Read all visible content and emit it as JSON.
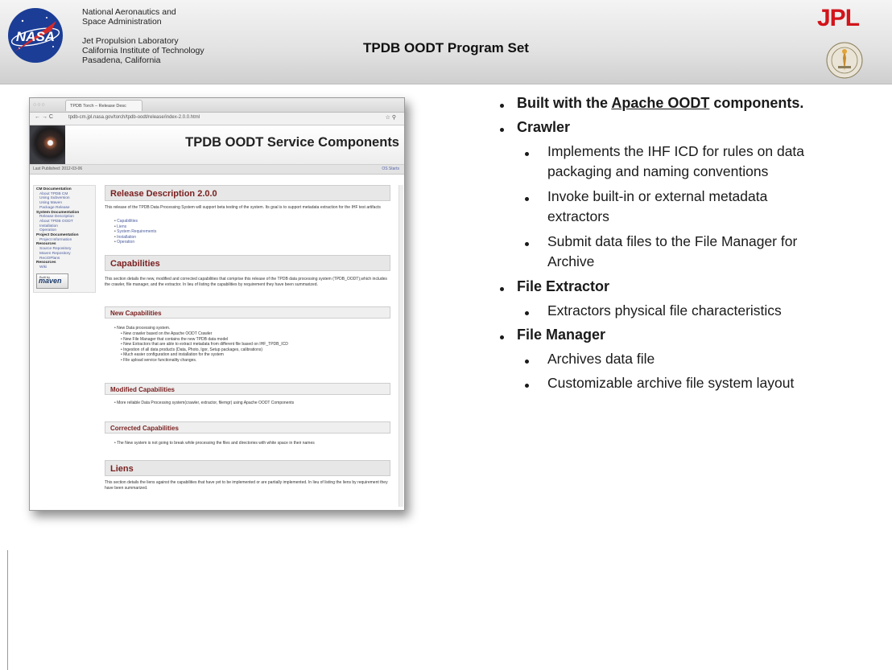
{
  "header": {
    "org_lines": [
      "National Aeronautics and",
      "Space Administration"
    ],
    "lab_lines": [
      "Jet Propulsion Laboratory",
      "California Institute of Technology",
      "Pasadena, California"
    ],
    "title": "TPDB OODT Program Set",
    "nasa_logo": "NASA",
    "jpl_logo": "JPL",
    "colors": {
      "nasa_blue": "#1b3d96",
      "nasa_red": "#d22b2b",
      "jpl_red": "#d2141b"
    }
  },
  "screenshot": {
    "tab_title": "TPDB Torch – Release Desc",
    "url": "tpdb-cm.jpl.nasa.gov/torch/tpdb-oodt/release/index-2.0.0.html",
    "site_title": "TPDB OODT Service Components",
    "last_published": "Last Published: 2012-03-06",
    "version": "OS Starts",
    "sidebar": [
      {
        "type": "h",
        "text": "CM Documentation"
      },
      {
        "type": "i",
        "text": "About TPDB CM"
      },
      {
        "type": "i",
        "text": "Using Subversion"
      },
      {
        "type": "i",
        "text": "Using Maven"
      },
      {
        "type": "i",
        "text": "Package Release"
      },
      {
        "type": "h",
        "text": "System Documentation"
      },
      {
        "type": "i",
        "text": "Release Description"
      },
      {
        "type": "i",
        "text": "About TPDB OODT"
      },
      {
        "type": "i",
        "text": "Installation"
      },
      {
        "type": "i",
        "text": "Operation"
      },
      {
        "type": "h",
        "text": "Project Documentation"
      },
      {
        "type": "i",
        "text": "Project Information"
      },
      {
        "type": "h",
        "text": "Resources"
      },
      {
        "type": "i",
        "text": "Source Repository"
      },
      {
        "type": "i",
        "text": "Maven Repository"
      },
      {
        "type": "i",
        "text": "ReciOPlans"
      },
      {
        "type": "h",
        "text": "Resources"
      },
      {
        "type": "i",
        "text": "Wiki"
      }
    ],
    "maven_small": "Built by",
    "maven_big": "maven",
    "release_heading": "Release Description 2.0.0",
    "release_text": "This release of the TPDB Data Processing System will support beta testing of the system. Its goal is to support metadata extraction for the IHF test artifacts",
    "release_links": [
      "Capabilities",
      "Liens",
      "System Requirements",
      "Installation",
      "Operation"
    ],
    "capabilities_heading": "Capabilities",
    "capabilities_text": "This section details the new, modified and corrected capabilities that comprise this release of the TPDB data processing system (TPDB_OODT),which includes the crawler, file manager, and the extractor. In lieu of listing the capabilities by requirement they have been summarized.",
    "new_heading": "New Capabilities",
    "new_items": [
      "New Data processing system.",
      "New crawler based on the Apache OODT Crawler",
      "New File Manager that contains the new TPDB data model",
      "New Extractors that are able to extract metadata from different file based on IHF_TPDB_ICD",
      "Ingestion of all data products (Data, Photo, Igor, Setup packages, calibrations)",
      "Much easier configuration and installation for the system",
      "File upload service functionality changes."
    ],
    "modified_heading": "Modified Capabilities",
    "modified_items": [
      "More reliable Data Processing system(crawler, extractor, filemgr) using Apache OODT Components"
    ],
    "corrected_heading": "Corrected Capabilities",
    "corrected_items": [
      "The New system is not going to break while processing the files and directories with white space in their names"
    ],
    "liens_heading": "Liens",
    "liens_text": "This section details the liens against the capabilities that have yet to be implemented or are partially implemented. In lieu of listing the liens by requirement they have been summarized."
  },
  "bullets": {
    "b1_prefix": "Built with the ",
    "b1_link": "Apache OODT",
    "b1_suffix": " components.",
    "b2": "Crawler",
    "b2_1a": "Implements the IHF ICD for rules on data",
    "b2_1b": "packaging and naming conventions",
    "b2_2a": "Invoke built-in or external metadata",
    "b2_2b": "extractors",
    "b2_3a": "Submit data files to the File Manager for",
    "b2_3b": "Archive",
    "b3": "File Extractor",
    "b3_1": "Extractors physical file characteristics",
    "b4": "File Manager",
    "b4_1": "Archives data file",
    "b4_2": "Customizable archive file system layout"
  }
}
